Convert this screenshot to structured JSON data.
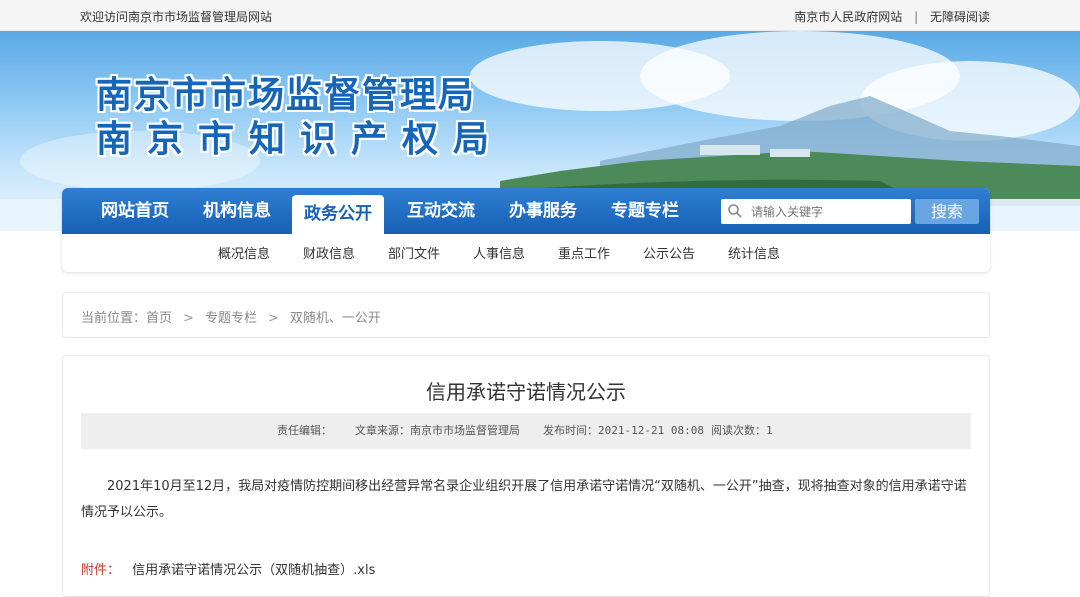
{
  "topbar": {
    "welcome": "欢迎访问南京市市场监督管理局网站",
    "gov_link": "南京市人民政府网站",
    "separator": "|",
    "accessibility": "无障碍阅读"
  },
  "banner": {
    "title_line1": "南京市市场监督管理局",
    "title_line2": "南京市知识产权局"
  },
  "nav": {
    "items": [
      "网站首页",
      "机构信息",
      "政务公开",
      "互动交流",
      "办事服务",
      "专题专栏"
    ],
    "active": "政务公开",
    "search_placeholder": "请输入关键字",
    "search_button": "搜索"
  },
  "subnav": {
    "items": [
      "概况信息",
      "财政信息",
      "部门文件",
      "人事信息",
      "重点工作",
      "公示公告",
      "统计信息"
    ]
  },
  "breadcrumb": {
    "label": "当前位置：",
    "items": [
      "首页",
      "专题专栏",
      "双随机、一公开"
    ],
    "separator": ">"
  },
  "article": {
    "title": "信用承诺守诺情况公示",
    "editor": "责任编辑：",
    "source": "文章来源：南京市市场监督管理局",
    "published": "发布时间：2021-12-21 08:08",
    "views": "阅读次数：1",
    "body": "2021年10月至12月，我局对疫情防控期间移出经营异常名录企业组织开展了信用承诺守诺情况“双随机、一公开”抽查，现将抽查对象的信用承诺守诺情况予以公示。",
    "attachment_label": "附件：",
    "attachment_file": "信用承诺守诺情况公示（双随机抽查）.xls"
  },
  "colors": {
    "nav_blue": "#1760b5",
    "title_blue": "#1565b8",
    "attachment_red": "#c0392b"
  }
}
